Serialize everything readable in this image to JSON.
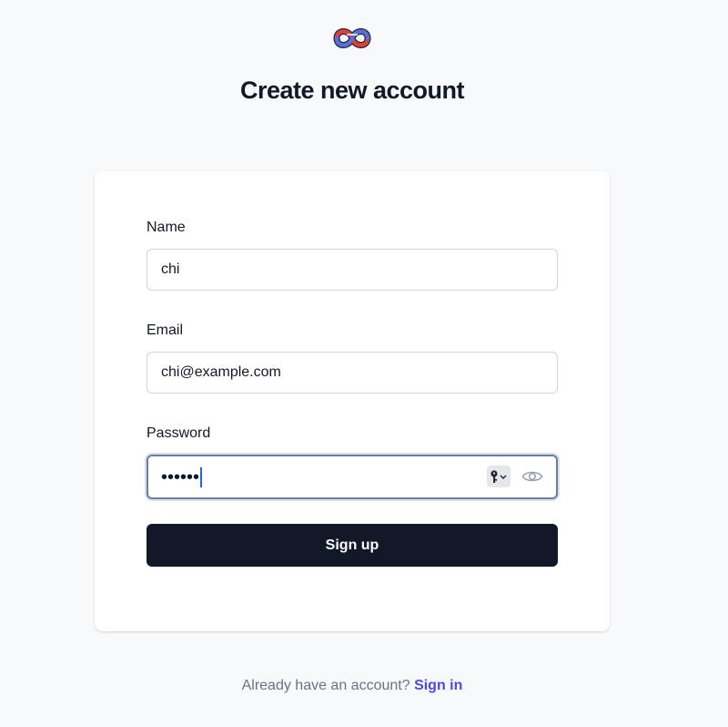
{
  "logo": {
    "icon": "knot-logo-icon",
    "colors": {
      "red": "#e0403a",
      "blue": "#5a6fd6",
      "dark": "#1f2937"
    }
  },
  "page_title": "Create new account",
  "form": {
    "name": {
      "label": "Name",
      "value": "chi"
    },
    "email": {
      "label": "Email",
      "value": "chi@example.com"
    },
    "password": {
      "label": "Password",
      "masked_value": "••••••",
      "keychain_icon": "key-icon",
      "toggle_icon": "eye-icon"
    },
    "submit_label": "Sign up"
  },
  "footer": {
    "prompt": "Already have an account?",
    "link_label": "Sign in"
  },
  "colors": {
    "background": "#f8f9fb",
    "primary_button": "#111827",
    "link": "#4f46e5",
    "focus_ring": "#6b7fa3"
  }
}
